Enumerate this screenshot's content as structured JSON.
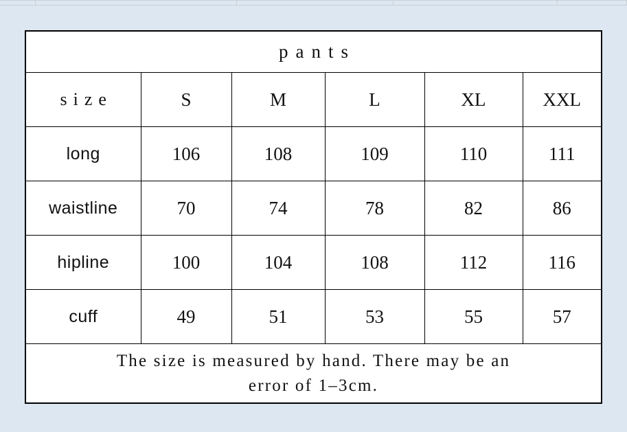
{
  "page": {
    "background_color": "#dce7f2",
    "table_border_color": "#000000",
    "table_background": "#ffffff",
    "text_color": "#111111"
  },
  "table": {
    "title": "pants",
    "size_header_label": "size",
    "sizes": [
      "S",
      "M",
      "L",
      "XL",
      "XXL"
    ],
    "rows": [
      {
        "label": "long",
        "values": [
          "106",
          "108",
          "109",
          "110",
          "111"
        ]
      },
      {
        "label": "waistline",
        "values": [
          "70",
          "74",
          "78",
          "82",
          "86"
        ]
      },
      {
        "label": "hipline",
        "values": [
          "100",
          "104",
          "108",
          "112",
          "116"
        ]
      },
      {
        "label": "cuff",
        "values": [
          "49",
          "51",
          "53",
          "55",
          "57"
        ]
      }
    ],
    "note": {
      "line1": "The size is measured by hand. There may be an",
      "line2": "error of 1–3cm."
    }
  },
  "chart_data": {
    "type": "table",
    "title": "pants",
    "columns": [
      "size",
      "S",
      "M",
      "L",
      "XL",
      "XXL"
    ],
    "rows": [
      [
        "long",
        106,
        108,
        109,
        110,
        111
      ],
      [
        "waistline",
        70,
        74,
        78,
        82,
        86
      ],
      [
        "hipline",
        100,
        104,
        108,
        112,
        116
      ],
      [
        "cuff",
        49,
        51,
        53,
        55,
        57
      ]
    ],
    "units": "cm",
    "footnote": "The size is measured by hand. There may be an error of 1–3cm."
  }
}
